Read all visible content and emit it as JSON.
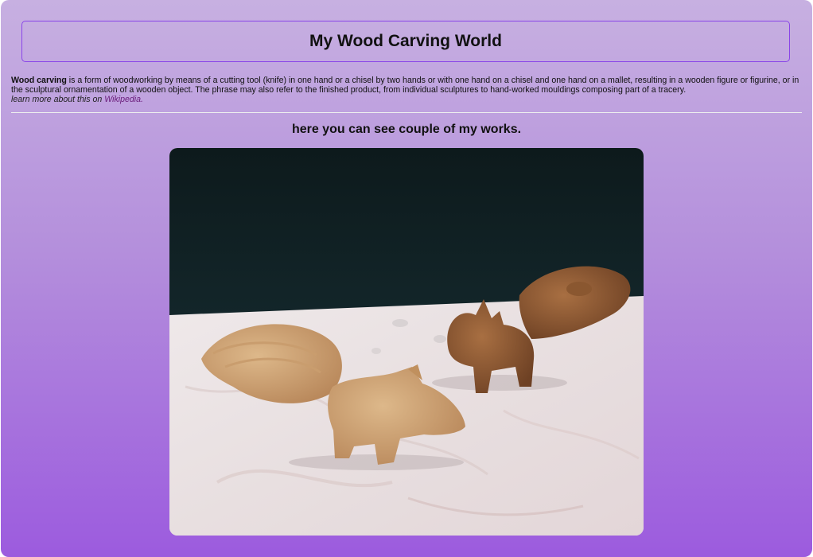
{
  "header": {
    "title": "My Wood Carving World"
  },
  "intro": {
    "term": "Wood carving",
    "text": " is a form of woodworking by means of a cutting tool (knife) in one hand or a chisel by two hands or with one hand on a chisel and one hand on a mallet, resulting in a wooden figure or figurine, or in the sculptural ornamentation of a wooden object. The phrase may also refer to the finished product, from individual sculptures to hand-worked mouldings composing part of a tracery.",
    "learn_more_prefix": "learn more about this on ",
    "learn_more_link": "Wikipedia."
  },
  "gallery": {
    "caption": "here you can see couple of my works."
  },
  "colors": {
    "border_accent": "#8a45e8",
    "link": "#6a1b7a",
    "gradient_top": "#c7b0e1",
    "gradient_bottom": "#9c5bde"
  }
}
